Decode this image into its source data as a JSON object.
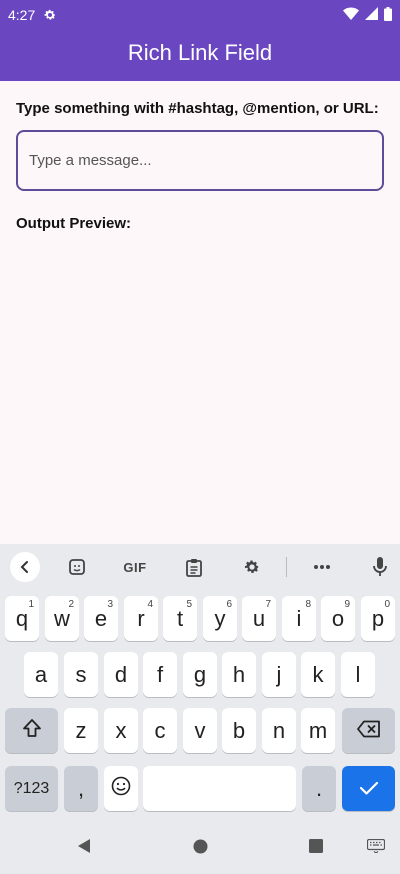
{
  "status_bar": {
    "time": "4:27"
  },
  "app_bar": {
    "title": "Rich Link Field"
  },
  "form": {
    "prompt_label": "Type something with #hashtag, @mention, or URL:",
    "input_placeholder": "Type a message...",
    "input_value": "",
    "preview_label": "Output Preview:"
  },
  "keyboard": {
    "toolbar": {
      "gif_label": "GIF"
    },
    "row1": [
      {
        "label": "q",
        "hint": "1"
      },
      {
        "label": "w",
        "hint": "2"
      },
      {
        "label": "e",
        "hint": "3"
      },
      {
        "label": "r",
        "hint": "4"
      },
      {
        "label": "t",
        "hint": "5"
      },
      {
        "label": "y",
        "hint": "6"
      },
      {
        "label": "u",
        "hint": "7"
      },
      {
        "label": "i",
        "hint": "8"
      },
      {
        "label": "o",
        "hint": "9"
      },
      {
        "label": "p",
        "hint": "0"
      }
    ],
    "row2": [
      "a",
      "s",
      "d",
      "f",
      "g",
      "h",
      "j",
      "k",
      "l"
    ],
    "row3": [
      "z",
      "x",
      "c",
      "v",
      "b",
      "n",
      "m"
    ],
    "symbols_label": "?123",
    "comma_label": ",",
    "period_label": "."
  },
  "colors": {
    "app_bar": "#6b46c1",
    "background": "#fef7fa",
    "input_border": "#5f4b99",
    "enter_key": "#1a73e8"
  },
  "icons": [
    "gear-icon",
    "wifi-icon",
    "signal-icon",
    "battery-icon",
    "chevron-left-icon",
    "sticker-icon",
    "clipboard-icon",
    "settings-icon",
    "more-icon",
    "mic-icon",
    "shift-icon",
    "backspace-icon",
    "emoji-icon",
    "checkmark-icon",
    "nav-back-icon",
    "nav-home-icon",
    "nav-recents-icon",
    "keyboard-switch-icon"
  ]
}
